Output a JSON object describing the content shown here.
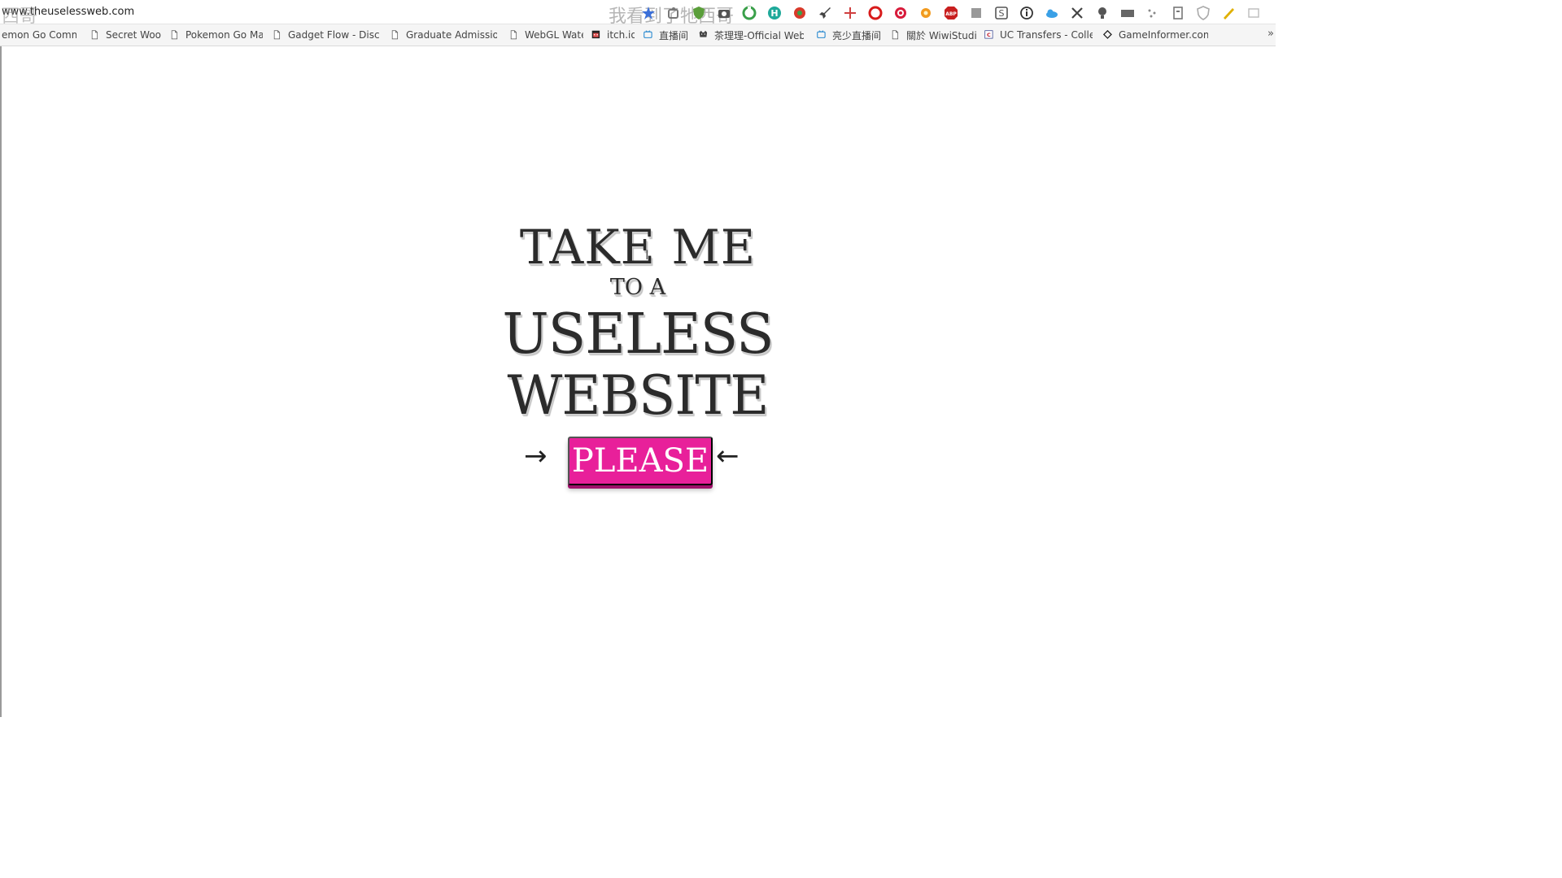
{
  "browser": {
    "url": "www.theuselessweb.com",
    "overlay_left": "西哥",
    "overlay_center": "我看到了牠西哥",
    "extensions": [
      {
        "name": "star-icon",
        "color": "#3b6fd8"
      },
      {
        "name": "puzzle-icon",
        "color": "#777777"
      },
      {
        "name": "shield-icon",
        "color": "#5a9e3a"
      },
      {
        "name": "camera-icon",
        "color": "#555555"
      },
      {
        "name": "recycle-icon",
        "color": "#3aa04a"
      },
      {
        "name": "h-circle-icon",
        "color": "#1fa99a"
      },
      {
        "name": "swirl-icon",
        "color": "#d83a2a"
      },
      {
        "name": "rocket-icon",
        "color": "#444444"
      },
      {
        "name": "cross-icon",
        "color": "#d04040"
      },
      {
        "name": "opera-icon",
        "color": "#d81b1b"
      },
      {
        "name": "target-icon",
        "color": "#d81b3b"
      },
      {
        "name": "flower-icon",
        "color": "#f29a1e"
      },
      {
        "name": "adblock-icon",
        "color": "#c81e1e"
      },
      {
        "name": "square-icon",
        "color": "#999999"
      },
      {
        "name": "s-box-icon",
        "color": "#555555"
      },
      {
        "name": "info-icon",
        "color": "#333333"
      },
      {
        "name": "cloud-icon",
        "color": "#3aa0e6"
      },
      {
        "name": "x-mark-icon",
        "color": "#444444"
      },
      {
        "name": "bulb-icon",
        "color": "#555555"
      },
      {
        "name": "bar-icon",
        "color": "#666666"
      },
      {
        "name": "dots-icon",
        "color": "#888888"
      },
      {
        "name": "doc-icon",
        "color": "#777777"
      },
      {
        "name": "shield-outline-icon",
        "color": "#aaaaaa"
      },
      {
        "name": "pen-icon",
        "color": "#e0b000"
      },
      {
        "name": "window-icon",
        "color": "#bbbbbb"
      }
    ]
  },
  "bookmarks": [
    {
      "label": "emon Go Commu",
      "icon": "none"
    },
    {
      "label": "Secret Wood",
      "icon": "page-icon"
    },
    {
      "label": "Pokemon Go Map",
      "icon": "page-icon"
    },
    {
      "label": "Gadget Flow - Discov",
      "icon": "page-icon"
    },
    {
      "label": "Graduate Admissions",
      "icon": "page-icon"
    },
    {
      "label": "WebGL Water",
      "icon": "page-icon"
    },
    {
      "label": "itch.io",
      "icon": "itchio-icon"
    },
    {
      "label": "直播间",
      "icon": "tv-icon"
    },
    {
      "label": "茶理理-Official Webs",
      "icon": "cat-icon"
    },
    {
      "label": "亮少直播间",
      "icon": "tv-icon"
    },
    {
      "label": "關於 WiwiStudio",
      "icon": "page-icon"
    },
    {
      "label": "UC Transfers - College",
      "icon": "uc-icon"
    },
    {
      "label": "GameInformer.com",
      "icon": "diamond-icon"
    }
  ],
  "bookmarks_overflow": "»",
  "hero": {
    "line1": "TAKE ME",
    "line2": "TO A",
    "line3": "USELESS",
    "line4": "WEBSITE",
    "arrow_left": "→",
    "arrow_right": "←",
    "button_label": "PLEASE",
    "button_color": "#e8209a",
    "cursor_glyph": "I"
  }
}
